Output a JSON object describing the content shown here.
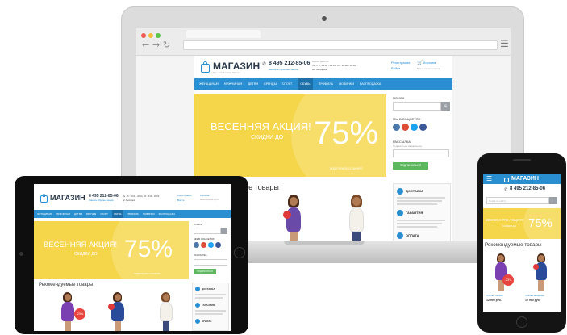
{
  "shop": {
    "logo_text": "МАГАЗИН",
    "logo_tagline": "Лучший Магазин Москвы",
    "phone": "8 495 212-85-06",
    "callback": "Заказать обратный звонок",
    "hours_title": "Время работы:",
    "hours_line1": "Пн - Пт: 09:00 - 20:00, Сб: 10:00 - 18:00",
    "hours_line2": "Вс: Выходной",
    "register": "Регистрация",
    "login": "Войти",
    "cart": "Корзина",
    "cart_sub": "Ваша корзина пуста"
  },
  "nav": [
    "ЖЕНЩИНАМ",
    "МУЖЧИНАМ",
    "ДЕТЯМ",
    "БРЕНДЫ",
    "СПОРТ",
    "ОБУВЬ",
    "ПРОФИЛЬ",
    "НОВИНКИ",
    "РАСПРОДАЖА"
  ],
  "banner": {
    "headline": "ВЕСЕННЯЯ АКЦИЯ!",
    "sub": "СКИДКИ ДО",
    "percent": "75%",
    "link": "ПОДРОБНЕЕ О БАНЕРЕ"
  },
  "sidebar": {
    "search_title": "ПОИСК",
    "social_title": "МЫ В СОЦСЕТЯХ",
    "subscribe_title": "РАССЫЛКА",
    "subscribe_placeholder": "Подписаться на рассылку",
    "subscribe_button": "ПОДПИСАТЬСЯ",
    "features": [
      {
        "title": "ДОСТАВКА",
        "text": "Доставка по всей стране в кратчайшие сроки"
      },
      {
        "title": "ГАРАНТИЯ",
        "text": "Гарантия на все товары"
      },
      {
        "title": "ОПЛАТА",
        "text": "Удобные способы оплаты"
      }
    ]
  },
  "recommended_title": "Рекомендуемые товары",
  "sale_badge": "-25%",
  "products": [
    {
      "name": "Платье летнее",
      "price": "12 990 руб."
    },
    {
      "name": "Платье вечернее",
      "price": "12 990 руб."
    },
    {
      "name": "Блуза белая",
      "price": "12 990 руб."
    }
  ],
  "phone_search_placeholder": "Поиск по сайту",
  "colors": {
    "accent": "#2a8fd0",
    "banner": "#f5d54a",
    "sale": "#e9433d",
    "button": "#5bb85d"
  }
}
